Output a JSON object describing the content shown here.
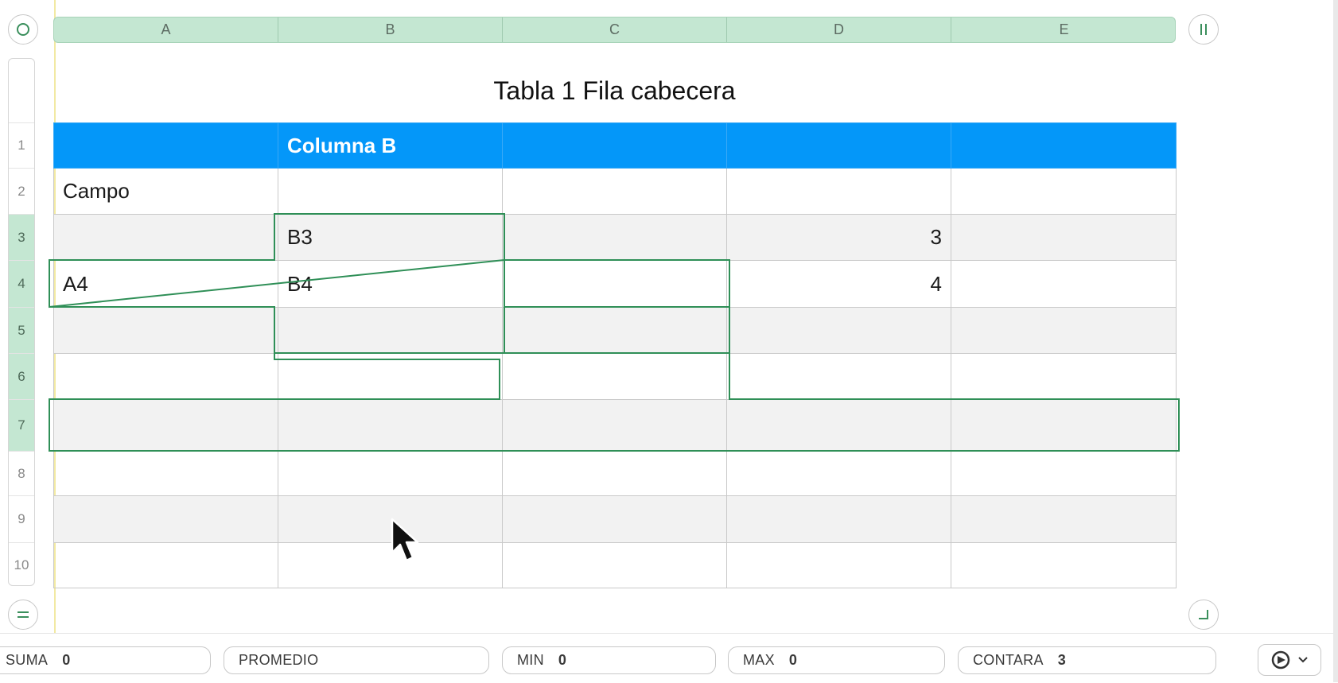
{
  "columns": [
    "A",
    "B",
    "C",
    "D",
    "E"
  ],
  "table": {
    "title": "Tabla 1 Fila cabecera",
    "rows": [
      {
        "num": "1",
        "cells": [
          "",
          "Columna B",
          "",
          "",
          ""
        ]
      },
      {
        "num": "2",
        "cells": [
          "Campo",
          "",
          "",
          "",
          ""
        ]
      },
      {
        "num": "3",
        "cells": [
          "",
          "B3",
          "",
          "3",
          ""
        ]
      },
      {
        "num": "4",
        "cells": [
          "A4",
          "B4",
          "",
          "4",
          ""
        ]
      },
      {
        "num": "5",
        "cells": [
          "",
          "",
          "",
          "",
          ""
        ]
      },
      {
        "num": "6",
        "cells": [
          "",
          "",
          "",
          "",
          ""
        ]
      },
      {
        "num": "7",
        "cells": [
          "",
          "",
          "",
          "",
          ""
        ]
      },
      {
        "num": "8",
        "cells": [
          "",
          "",
          "",
          "",
          ""
        ]
      },
      {
        "num": "9",
        "cells": [
          "",
          "",
          "",
          "",
          ""
        ]
      },
      {
        "num": "10",
        "cells": [
          "",
          "",
          "",
          "",
          ""
        ]
      }
    ],
    "selected_rows": [
      "3",
      "4",
      "5",
      "6",
      "7"
    ]
  },
  "status": {
    "items": [
      {
        "label": "SUMA",
        "value": "0"
      },
      {
        "label": "PROMEDIO",
        "value": ""
      },
      {
        "label": "MIN",
        "value": "0"
      },
      {
        "label": "MAX",
        "value": "0"
      },
      {
        "label": "CONTARA",
        "value": "3"
      }
    ]
  },
  "icons": {
    "select_table": "circle-icon",
    "freeze_columns": "pause-bars-icon",
    "add_rows": "equals-icon",
    "resize_table": "corner-icon",
    "options": "gear-chevron-icon",
    "pointer": "mouse-pointer-icon"
  },
  "colors": {
    "header_fill": "#0497f9",
    "selection_header": "#c4e7d2",
    "selection_outline": "#2f8f57",
    "alt_row": "#f2f2f2"
  }
}
